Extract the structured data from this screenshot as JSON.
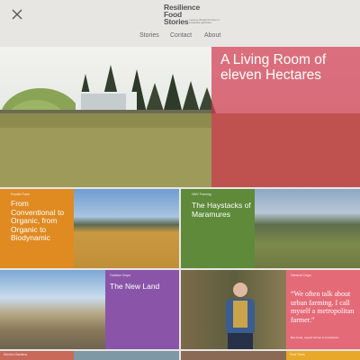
{
  "header": {
    "logo": [
      "Resilience",
      "Food",
      "Stories"
    ],
    "tagline": "A journey through the future of sustainable agriculture",
    "nav": [
      "Stories",
      "Contact",
      "About"
    ]
  },
  "hero": {
    "title": "A Living Room of eleven Hectares"
  },
  "cards": [
    {
      "tag": "Frontier Farm",
      "title": "From Conventional to Organic, from Organic to Biodynamic"
    },
    {
      "tag": "HMV Farming",
      "title": "The Haystacks of Maramures"
    },
    {
      "tag": "Outdoor Crops",
      "title": "The New Land"
    },
    {
      "tag": "General Crops",
      "quote": "“We often talk about urban farming. I call myself a metropolitan farmer.”",
      "author": "Ben Hoek, organic farmer in Amsterdam"
    },
    {
      "tag": "Kitchen Gardens"
    },
    {
      "tag": ""
    },
    {
      "tag": "Fruit Trees"
    }
  ]
}
